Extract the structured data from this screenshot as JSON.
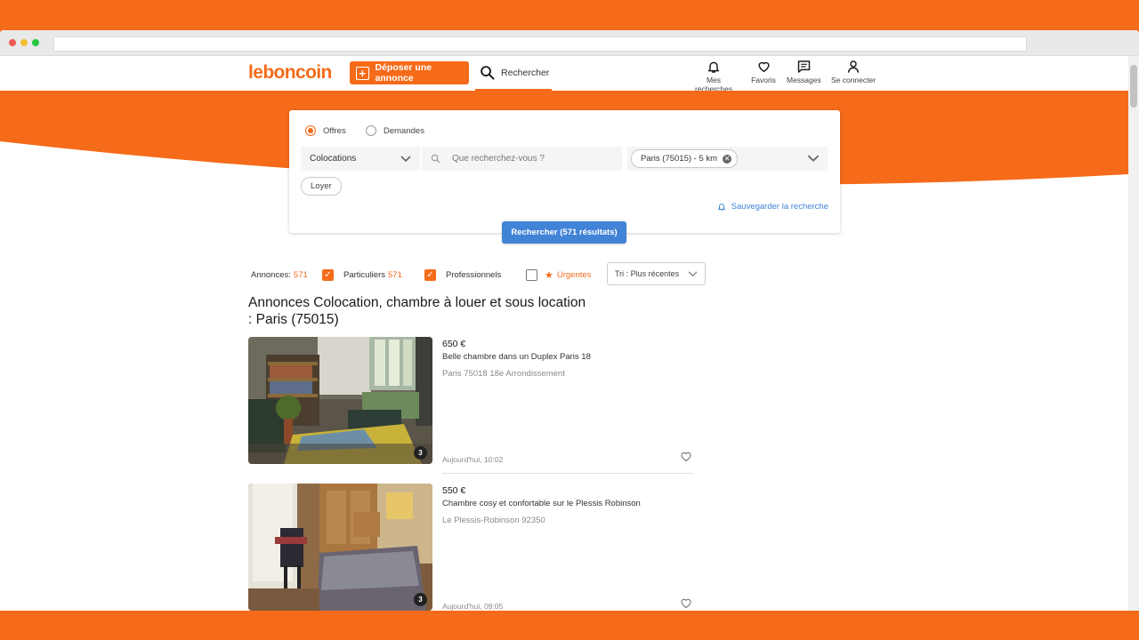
{
  "brand": {
    "logo": "leboncoin",
    "accent": "#f56b1a",
    "link_blue": "#4183d7"
  },
  "header": {
    "post_ad_label": "Déposer une annonce",
    "search_tab_label": "Rechercher",
    "nav": [
      {
        "icon": "bell-icon",
        "label": "Mes recherches"
      },
      {
        "icon": "heart-icon",
        "label": "Favoris"
      },
      {
        "icon": "message-icon",
        "label": "Messages"
      },
      {
        "icon": "user-icon",
        "label": "Se connecter"
      }
    ]
  },
  "search": {
    "radio_offers": "Offres",
    "radio_requests": "Demandes",
    "radio_selected": "Offres",
    "category": "Colocations",
    "query_placeholder": "Que recherchez-vous ?",
    "location_chip": "Paris (75015) - 5 km",
    "filter_chip": "Loyer",
    "save_label": "Sauvegarder la recherche",
    "submit_label": "Rechercher (571 résultats)"
  },
  "filters": {
    "annonces_label": "Annonces:",
    "annonces_count": "571",
    "particuliers_label": "Particuliers",
    "particuliers_count": "571",
    "particuliers_checked": true,
    "professionnels_label": "Professionnels",
    "professionnels_checked": true,
    "urgentes_label": "Urgentes",
    "urgentes_checked": false,
    "sort_label": "Tri : Plus récentes"
  },
  "page_title": "Annonces Colocation, chambre à louer et sous location : Paris (75015)",
  "listings": [
    {
      "price": "650 €",
      "title": "Belle chambre dans un Duplex Paris 18",
      "location": "Paris 75018 18e Arrondissement",
      "date": "Aujourd'hui, 10:02",
      "photo_count": "3"
    },
    {
      "price": "550 €",
      "title": "Chambre cosy et confortable sur le Plessis Robinson",
      "location": "Le Plessis-Robinson 92350",
      "date": "Aujourd'hui, 09:05",
      "photo_count": "3"
    }
  ]
}
